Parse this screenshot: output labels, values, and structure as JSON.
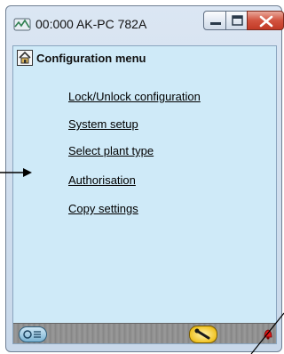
{
  "window": {
    "title": "00:000 AK-PC 782A",
    "app_icon": "network-monitor-icon",
    "buttons": {
      "minimize": "minimize-icon",
      "maximize": "maximize-icon",
      "close": "close-icon"
    }
  },
  "menu": {
    "title": "Configuration menu",
    "home_icon": "home-icon",
    "items": [
      {
        "label": "Lock/Unlock configuration"
      },
      {
        "label": "System setup"
      },
      {
        "label": "Select plant type"
      },
      {
        "label": "Authorisation"
      },
      {
        "label": "Copy settings"
      }
    ]
  },
  "statusbar": {
    "left_icon": "logout-icon",
    "center_icon": "wrench-icon",
    "right_icon": "alarm-bell-icon"
  },
  "colors": {
    "client_background": "#cfeaf8",
    "close_button": "#d2533f",
    "statusbar": "#8c8c8c"
  }
}
